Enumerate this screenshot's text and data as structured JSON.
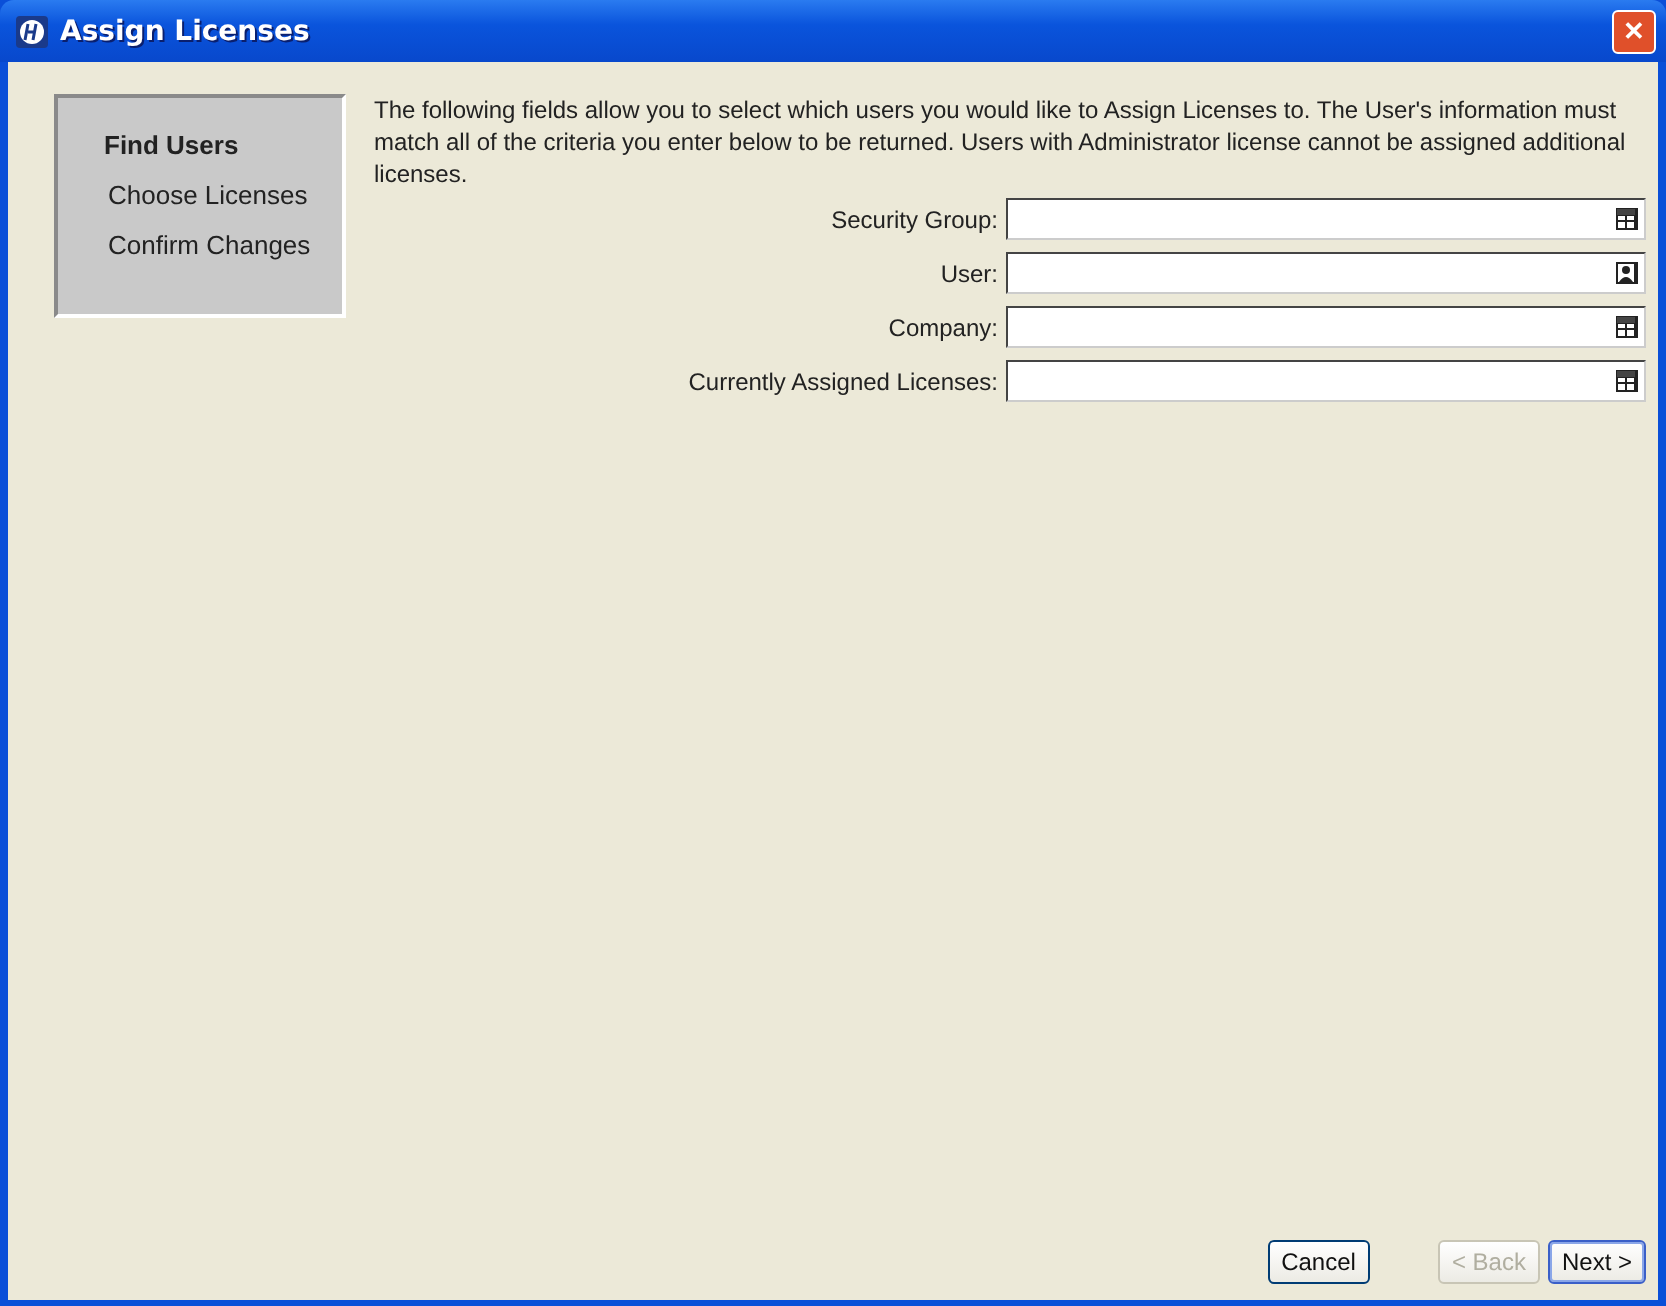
{
  "window": {
    "title": "Assign Licenses",
    "close": "✕"
  },
  "steps": [
    {
      "label": "Find Users",
      "selected": true
    },
    {
      "label": "Choose Licenses",
      "selected": false
    },
    {
      "label": "Confirm Changes",
      "selected": false
    }
  ],
  "description": "The following fields allow you to select which users you would like to Assign Licenses to. The User's information must match all of the criteria you enter below to be returned. Users with Administrator license cannot be assigned additional licenses.",
  "fields": [
    {
      "label": "Security Group:",
      "kind": "list"
    },
    {
      "label": "User:",
      "kind": "person"
    },
    {
      "label": "Company:",
      "kind": "list"
    },
    {
      "label": "Currently Assigned Licenses:",
      "kind": "list"
    }
  ],
  "buttons": [
    {
      "label": "Cancel",
      "disabled": false,
      "default": false
    },
    {
      "label": "< Back",
      "disabled": true,
      "default": false
    },
    {
      "label": "Next >",
      "disabled": false,
      "default": true
    }
  ]
}
